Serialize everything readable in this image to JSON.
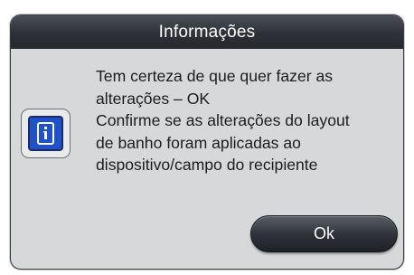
{
  "dialog": {
    "title": "Informações",
    "message_lines": [
      "Tem certeza de que quer fazer as",
      "alterações – OK",
      "Confirme se as alterações do layout",
      "de banho foram aplicadas ao",
      "dispositivo/campo do recipiente"
    ],
    "ok_label": "Ok"
  },
  "icons": {
    "info": "info-icon"
  },
  "colors": {
    "title_bar": "#2d3137",
    "dialog_bg": "#d7d8d9",
    "info_icon_blue": "#1f52c8",
    "button": "#30343a"
  }
}
